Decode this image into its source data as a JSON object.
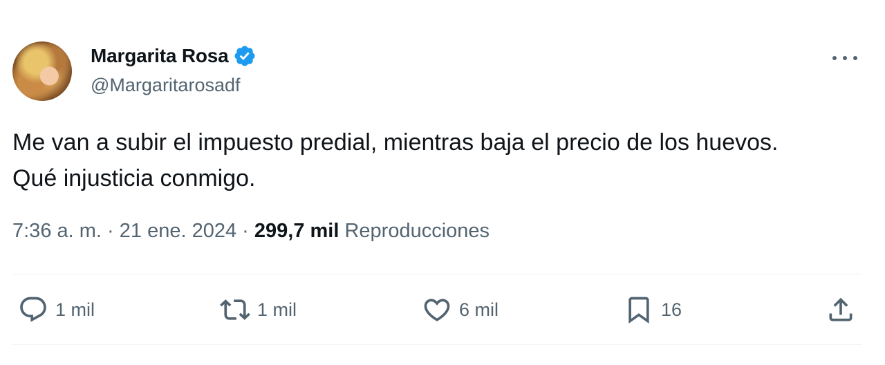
{
  "tweet": {
    "author": {
      "display_name": "Margarita Rosa",
      "handle": "@Margaritarosadf",
      "verified": true,
      "avatar_icon": "profile-photo"
    },
    "text_lines": [
      "Me van a subir el impuesto predial, mientras baja el precio de los huevos.",
      "Qué injusticia conmigo."
    ],
    "meta": {
      "time": "7:36 a. m.",
      "separator": "·",
      "date": "21 ene. 2024",
      "views_count": "299,7 mil",
      "views_label": "Reproducciones"
    },
    "actions": {
      "reply": {
        "icon": "reply-icon",
        "count": "1 mil"
      },
      "retweet": {
        "icon": "retweet-icon",
        "count": "1 mil"
      },
      "like": {
        "icon": "heart-icon",
        "count": "6 mil"
      },
      "bookmark": {
        "icon": "bookmark-icon",
        "count": "16"
      },
      "share": {
        "icon": "share-icon"
      }
    },
    "more_icon": "more-options-icon"
  },
  "colors": {
    "text_primary": "#0f1419",
    "text_secondary": "#536471",
    "verified_blue": "#1d9bf0",
    "divider": "#eff3f4"
  }
}
